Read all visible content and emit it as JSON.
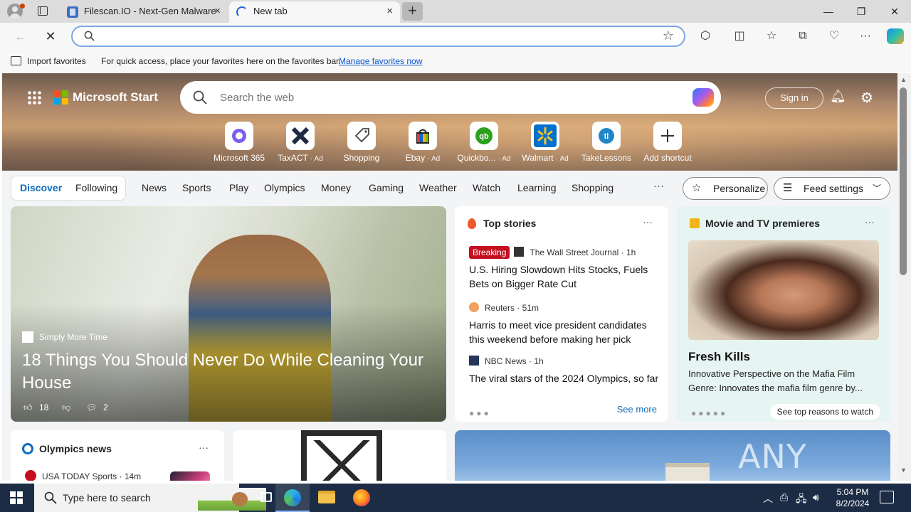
{
  "browser": {
    "tabs": [
      {
        "title": "Filescan.IO - Next-Gen Malware A",
        "close": "×"
      },
      {
        "title": "New tab",
        "close": "×"
      }
    ],
    "new_tab": "+",
    "window_controls": {
      "minimize": "—",
      "maximize": "❐",
      "close": "✕"
    },
    "address_bar": {
      "value": "",
      "placeholder": ""
    }
  },
  "favorites_bar": {
    "import_label": "Import favorites",
    "message": "For quick access, place your favorites here on the favorites bar.",
    "manage_link": "Manage favorites now"
  },
  "start_page": {
    "brand": "Microsoft Start",
    "search_placeholder": "Search the web",
    "sign_in": "Sign in",
    "shortcuts": [
      {
        "label": "Microsoft 365",
        "ad": "",
        "icon": "microsoft-365-icon",
        "color": "#7a5cf0"
      },
      {
        "label": "TaxACT",
        "ad": "· Ad",
        "icon": "taxact-icon",
        "color": "#1f2a44"
      },
      {
        "label": "Shopping",
        "ad": "",
        "icon": "tag-icon",
        "color": "#555555"
      },
      {
        "label": "Ebay",
        "ad": "· Ad",
        "icon": "ebay-icon",
        "color": "#e53238"
      },
      {
        "label": "Quickbo...",
        "ad": "· Ad",
        "icon": "quickbooks-icon",
        "color": "#2ca01c"
      },
      {
        "label": "Walmart",
        "ad": "· Ad",
        "icon": "walmart-icon",
        "color": "#0071ce"
      },
      {
        "label": "TakeLessons",
        "ad": "",
        "icon": "takelessons-icon",
        "color": "#1f87c9"
      },
      {
        "label": "Add shortcut",
        "ad": "",
        "icon": "plus-icon",
        "color": "#333333"
      }
    ],
    "feed_tabs": {
      "discover": "Discover",
      "following": "Following"
    },
    "categories": [
      "News",
      "Sports",
      "Play",
      "Olympics",
      "Money",
      "Gaming",
      "Weather",
      "Watch",
      "Learning",
      "Shopping"
    ],
    "more": "···",
    "personalize": "Personalize",
    "feed_settings": "Feed settings",
    "hero": {
      "source": "Simply More Time",
      "title": "18 Things You Should Never Do While Cleaning Your House",
      "likes": "18",
      "comments": "2"
    },
    "top_stories": {
      "heading": "Top stories",
      "items": [
        {
          "badge": "Breaking",
          "publisher": "The Wall Street Journal · 1h",
          "headline": "U.S. Hiring Slowdown Hits Stocks, Fuels Bets on Bigger Rate Cut"
        },
        {
          "badge": "",
          "publisher": "Reuters · 51m",
          "headline": "Harris to meet vice president candidates this weekend before making her pick"
        },
        {
          "badge": "",
          "publisher": "NBC News · 1h",
          "headline": "The viral stars of the 2024 Olympics, so far"
        }
      ],
      "see_more": "See more"
    },
    "movie": {
      "heading": "Movie and TV premieres",
      "title": "Fresh Kills",
      "description": "Innovative Perspective on the Mafia Film Genre: Innovates the mafia film genre by...",
      "cta": "See top reasons to watch"
    },
    "olympics": {
      "heading": "Olympics news",
      "source": "USA TODAY Sports · 14m"
    },
    "watermark": "ANY RUN"
  },
  "taskbar": {
    "search_placeholder": "Type here to search",
    "time": "5:04 PM",
    "date": "8/2/2024"
  }
}
